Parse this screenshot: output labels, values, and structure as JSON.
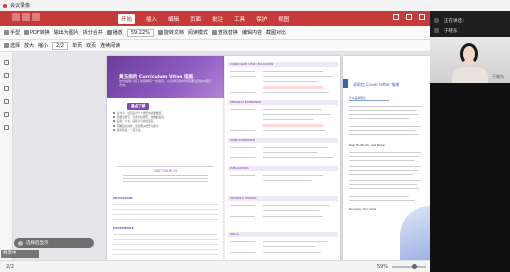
{
  "meeting_bar": {
    "title": "会议录像"
  },
  "app": {
    "tabs": [
      {
        "label": "新标签"
      },
      {
        "label": ""
      }
    ],
    "menu": [
      "开始",
      "插入",
      "编辑",
      "页面",
      "批注",
      "工具",
      "保护",
      "视图"
    ],
    "active_menu": "开始",
    "toolbar1": {
      "hand": "手型",
      "select": "选择",
      "pdf_convert": "PDF转换",
      "to_image": "输出为图片",
      "split_merge": "拆分合并",
      "play": "播放",
      "zoom": "59.22%",
      "page": "2/2",
      "rotate": "旋转文档",
      "single": "单页",
      "double": "双页",
      "continuous": "连续阅读",
      "read_mode": "阅读模式",
      "find": "查找替换",
      "annotate": "编辑内容",
      "cut": "截图对比",
      "more": "更多"
    },
    "toolbar2": {
      "select_label": "选择",
      "zoom_in": "放大",
      "zoom_out": "缩小",
      "fit": "适合页面",
      "page": "2/2"
    },
    "document": {
      "page1": {
        "title": "黄玉雨的 Curriculum Vitae 指南",
        "subtitle": "这份指南介绍了如何撰写一份简历，以及撰写的时候需要注意的内容与方法。",
        "pill": "重点了解",
        "bullets": [
          "是什么：简历是对个人经历的简要概括。",
          "需要怎样写：分条列出经历，用数据说话。",
          "避免：冗长、错别字与格式混乱。",
          "明确目标岗位，突出相关经历与能力。",
          "保持简洁，一页为宜。"
        ],
        "resume_title": "CAST YOUR CV",
        "section_edu": "EDUCATION",
        "section_exp": "EXPERIENCE"
      },
      "page2": {
        "sections": [
          "CURRICULUM VITAE / EDUCATION",
          "RESEARCH EXPERIENCE",
          "WORK EXPERIENCE",
          "PUBLICATIONS",
          "AWARDS & HONORS",
          "SKILLS"
        ]
      },
      "page3": {
        "title": "求职信 Cover letter 指南",
        "heading1": "什么是求职信",
        "heading2": "Dear Mr./Ms./Dr. Last Name:",
        "heading3": "Sincerely, Your name"
      }
    },
    "status": {
      "page": "2/2",
      "zoom": "59%"
    },
    "chip": {
      "label": "选择后显示"
    },
    "chip2": {
      "label": "共享中"
    }
  },
  "video": {
    "name1": "正在讲话：",
    "name2": "于晓东",
    "participant_label": "于晓东"
  },
  "colors": {
    "brand": "#c73a3a",
    "purple": "#7b4db0",
    "blue": "#3d5fb8"
  }
}
